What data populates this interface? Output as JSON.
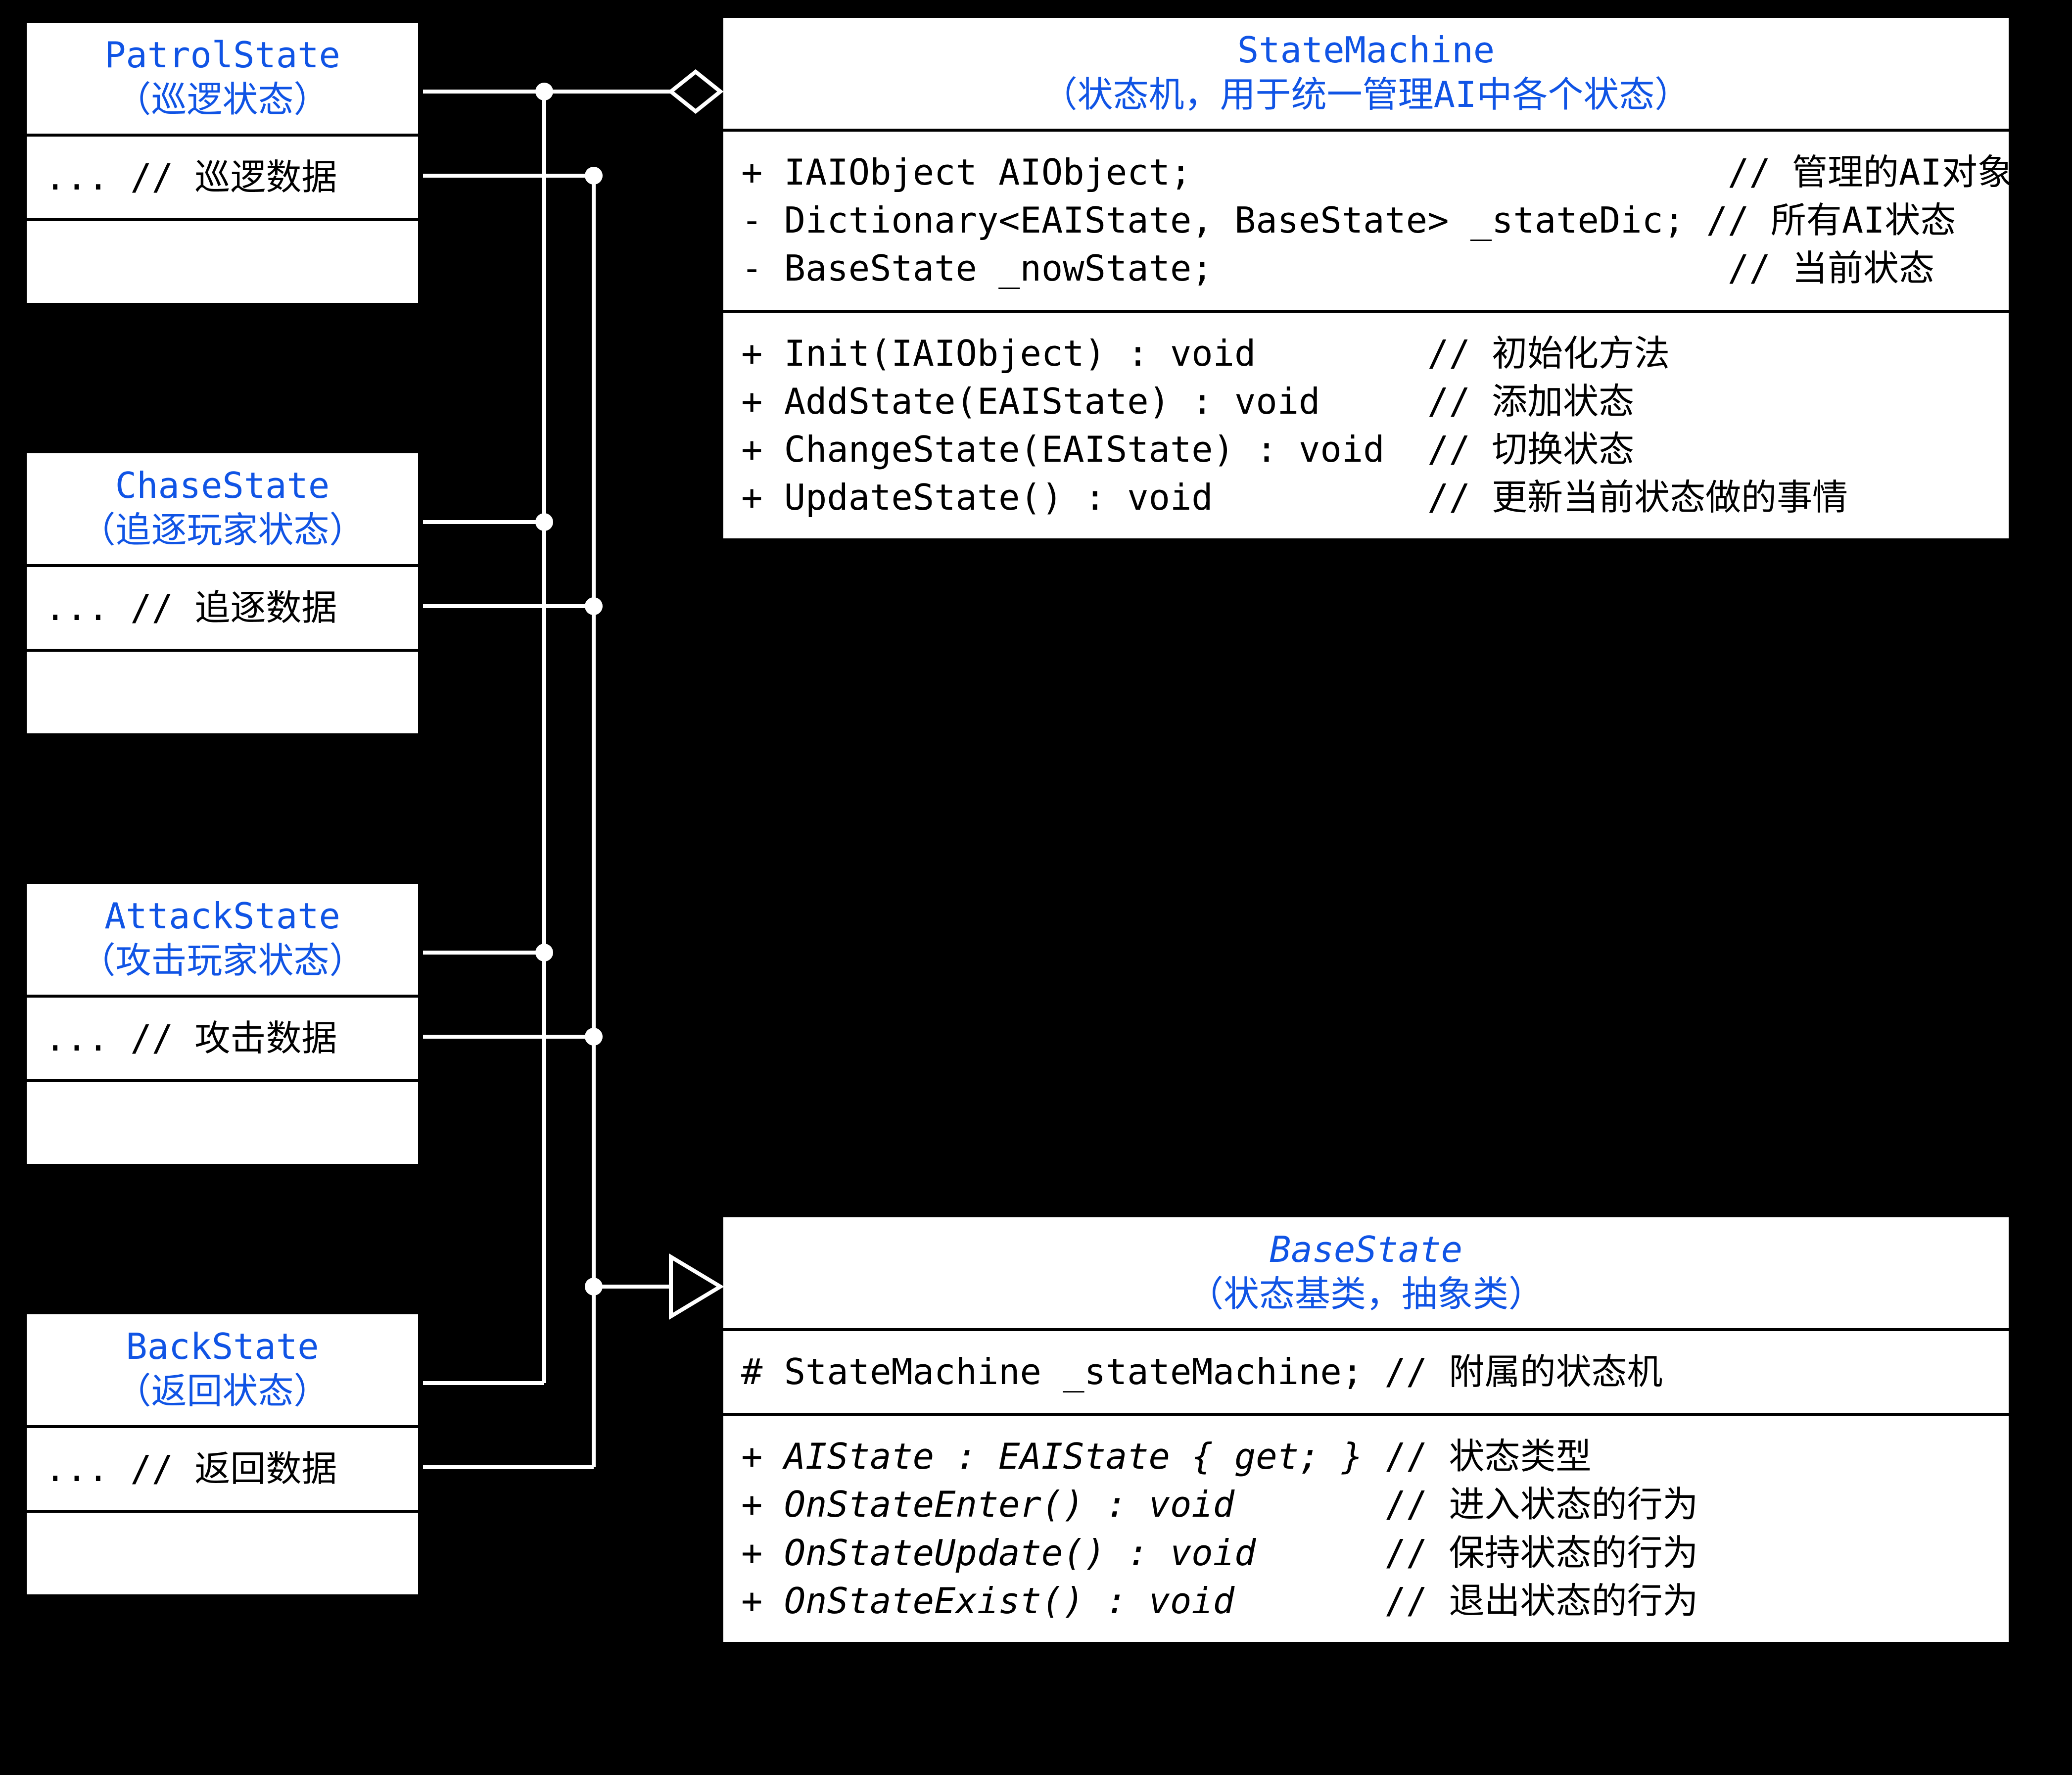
{
  "patrol": {
    "name": "PatrolState",
    "sub": "（巡逻状态）",
    "attrs": "... // 巡逻数据",
    "methods": " "
  },
  "chase": {
    "name": "ChaseState",
    "sub": "（追逐玩家状态）",
    "attrs": "... // 追逐数据",
    "methods": " "
  },
  "attack": {
    "name": "AttackState",
    "sub": "（攻击玩家状态）",
    "attrs": "... // 攻击数据",
    "methods": " "
  },
  "back": {
    "name": "BackState",
    "sub": "（返回状态）",
    "attrs": "... // 返回数据",
    "methods": " "
  },
  "machine": {
    "name": "StateMachine",
    "sub": "（状态机，用于统一管理AI中各个状态）",
    "attrs": "+ IAIObject AIObject;                         // 管理的AI对象\n- Dictionary<EAIState, BaseState> _stateDic; // 所有AI状态\n- BaseState _nowState;                        // 当前状态",
    "methods": "+ Init(IAIObject) : void        // 初始化方法\n+ AddState(EAIState) : void     // 添加状态\n+ ChangeState(EAIState) : void  // 切换状态\n+ UpdateState() : void          // 更新当前状态做的事情"
  },
  "base": {
    "name": "BaseState",
    "sub": "（状态基类，抽象类）",
    "attrs": "# StateMachine _stateMachine; // 附属的状态机",
    "methods_prefix": [
      "+ ",
      "+ ",
      "+ ",
      "+ "
    ],
    "methods_sig": [
      "AIState : EAIState { get; }",
      "OnStateEnter() : void",
      "OnStateUpdate() : void",
      "OnStateExist() : void"
    ],
    "methods_comment": [
      " // 状态类型",
      "       // 进入状态的行为",
      "      // 保持状态的行为",
      "       // 退出状态的行为"
    ]
  }
}
